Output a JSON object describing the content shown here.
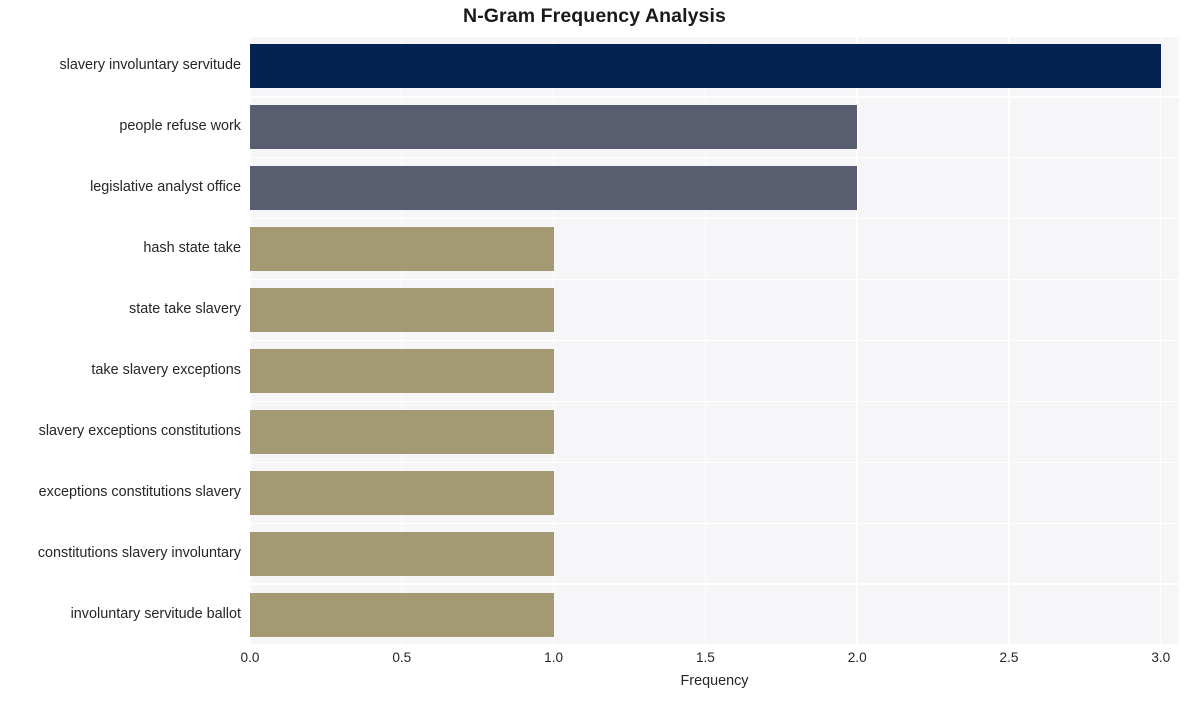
{
  "chart_data": {
    "type": "bar",
    "orientation": "horizontal",
    "title": "N-Gram Frequency Analysis",
    "xlabel": "Frequency",
    "ylabel": "",
    "categories": [
      "slavery involuntary servitude",
      "people refuse work",
      "legislative analyst office",
      "hash state take",
      "state take slavery",
      "take slavery exceptions",
      "slavery exceptions constitutions",
      "exceptions constitutions slavery",
      "constitutions slavery involuntary",
      "involuntary servitude ballot"
    ],
    "values": [
      3,
      2,
      2,
      1,
      1,
      1,
      1,
      1,
      1,
      1
    ],
    "bar_colors": [
      "#052350",
      "#585d70",
      "#585d70",
      "#a39a74",
      "#a39a74",
      "#a39a74",
      "#a39a74",
      "#a39a74",
      "#a39a74",
      "#a39a74"
    ],
    "xlim": [
      0,
      3.06
    ],
    "xticks": [
      0.0,
      0.5,
      1.0,
      1.5,
      2.0,
      2.5,
      3.0
    ],
    "xtick_labels": [
      "0.0",
      "0.5",
      "1.0",
      "1.5",
      "2.0",
      "2.5",
      "3.0"
    ],
    "grid": true,
    "grid_color": "#ffffff",
    "plot_background": "#f6f6f8",
    "figure_background": "#ffffff",
    "legend": null
  }
}
